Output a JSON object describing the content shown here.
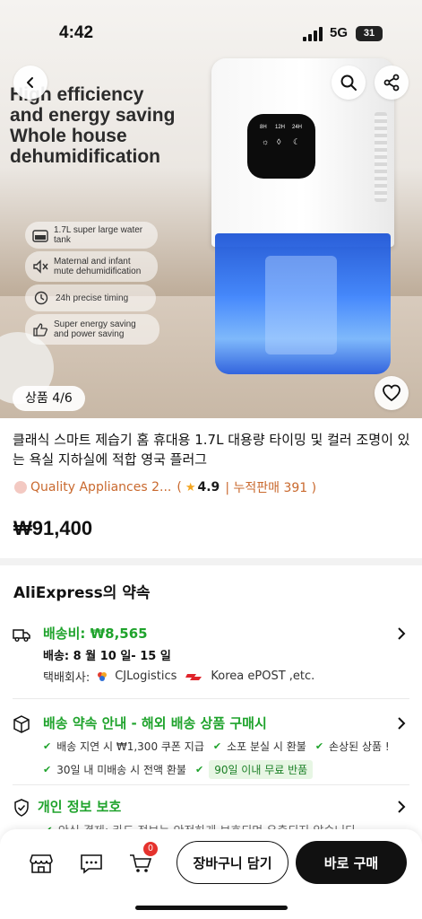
{
  "status_bar": {
    "time": "4:42",
    "network": "5G",
    "battery": "31"
  },
  "hero": {
    "headline": [
      "High efficiency",
      "and energy saving",
      "Whole house",
      "dehumidification"
    ],
    "features": [
      {
        "icon": "water-tank-icon",
        "text": "1.7L super large water tank"
      },
      {
        "icon": "mute-icon",
        "text": "Maternal and infant mute dehumidification"
      },
      {
        "icon": "timer-icon",
        "text": "24h precise timing"
      },
      {
        "icon": "thumbs-up-icon",
        "text": "Super energy saving and power saving"
      }
    ],
    "panel_labels": [
      "8H",
      "12H",
      "24H"
    ],
    "image_counter": "상품 4/6"
  },
  "product": {
    "title": "클래식 스마트 제습기 홈 휴대용 1.7L 대용량 타이밍 및 컬러 조명이 있는 욕실 지하실에 적합 영국 플러그",
    "store_name": "Quality Appliances 2...",
    "rating_open": "(",
    "rating": "4.9",
    "sales": "| 누적판매 391 )",
    "price": "₩91,400"
  },
  "promise": {
    "section_title": "AliExpress의 약속",
    "shipping_fee": "배송비: ₩8,565",
    "shipping_date": "배송: 8 월 10 일- 15 일",
    "carrier_label": "택배회사:",
    "carrier_1": "CJLogistics",
    "carrier_2": "Korea ePOST ,etc.",
    "guarantee_title": "배송 약속 안내 - 해외 배송 상품 구매시",
    "checks_row1": [
      "배송 지연 시 ₩1,300 쿠폰 지급",
      "소포 분실 시 환불",
      "손상된 상품 !"
    ],
    "checks_row2": [
      "30일 내 미배송 시 전액 환불"
    ],
    "free_return": "90일 이내 무료 반품",
    "privacy_title": "개인 정보 보호",
    "privacy_sub": "안심 결제: 카드 정보는 안전하게 보호되며 유출되지 않습니다"
  },
  "bottom_bar": {
    "cart_count": "0",
    "add_to_cart": "장바구니 담기",
    "buy_now": "바로 구매"
  },
  "colors": {
    "accent_green": "#1fa32c",
    "store_orange": "#c9692e",
    "badge_red": "#e5322d"
  }
}
